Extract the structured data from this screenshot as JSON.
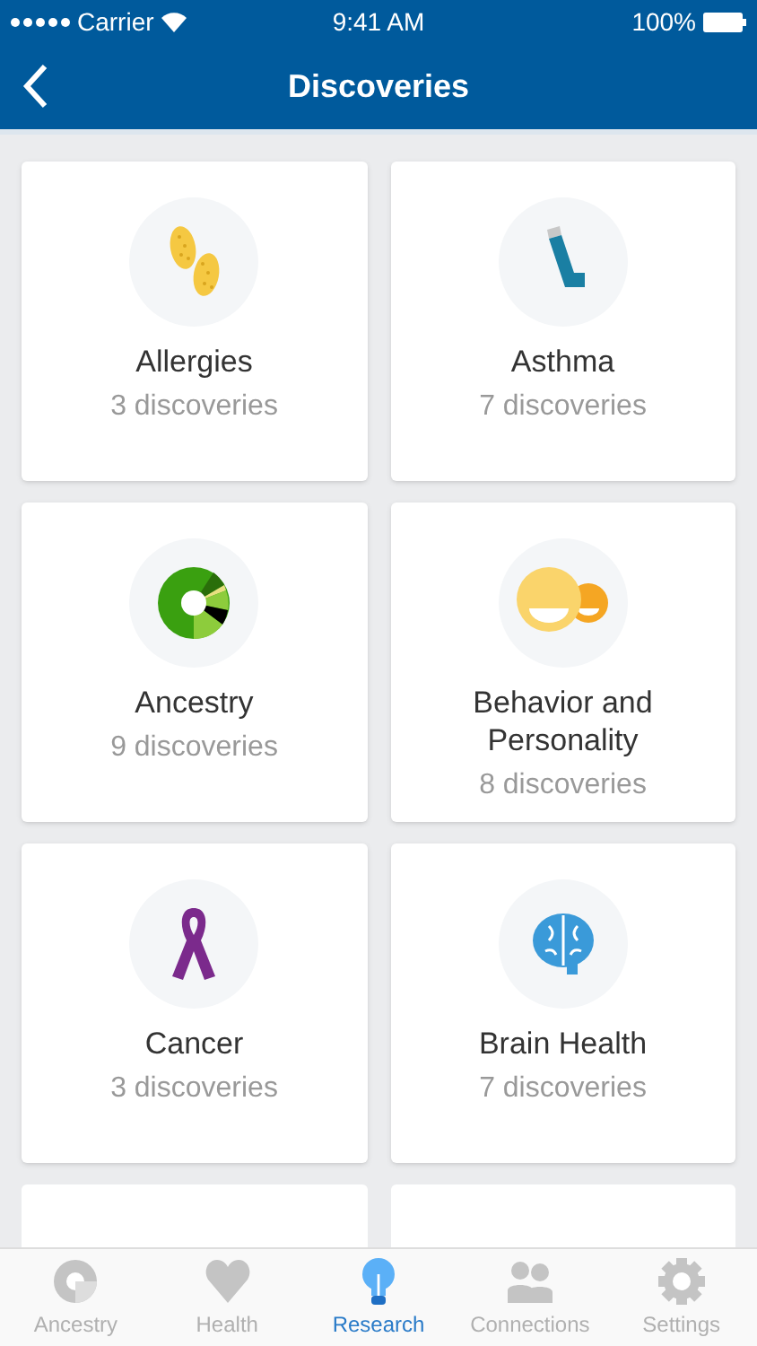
{
  "status_bar": {
    "carrier": "Carrier",
    "time": "9:41 AM",
    "battery": "100%"
  },
  "nav": {
    "title": "Discoveries"
  },
  "categories": [
    {
      "name": "Allergies",
      "count": "3 discoveries"
    },
    {
      "name": "Asthma",
      "count": "7 discoveries"
    },
    {
      "name": "Ancestry",
      "count": "9 discoveries"
    },
    {
      "name": "Behavior and Personality",
      "count": "8 discoveries"
    },
    {
      "name": "Cancer",
      "count": "3 discoveries"
    },
    {
      "name": "Brain Health",
      "count": "7 discoveries"
    }
  ],
  "tabs": [
    {
      "label": "Ancestry",
      "selected": false
    },
    {
      "label": "Health",
      "selected": false
    },
    {
      "label": "Research",
      "selected": true
    },
    {
      "label": "Connections",
      "selected": false
    },
    {
      "label": "Settings",
      "selected": false
    }
  ]
}
